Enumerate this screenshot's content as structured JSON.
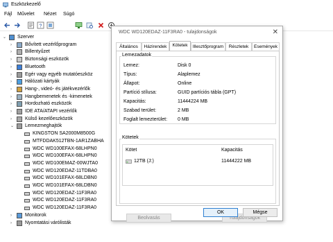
{
  "app": {
    "title": "Eszközkezelő",
    "menu": [
      "Fájl",
      "Művelet",
      "Nézet",
      "Súgó"
    ]
  },
  "toolbar": {
    "icons": [
      "back-arrow-icon",
      "forward-arrow-icon",
      "properties-icon",
      "help-icon",
      "update-driver-icon",
      "monitor-icon",
      "disable-device-icon",
      "uninstall-x-icon",
      "scan-hardware-icon"
    ]
  },
  "tree": {
    "root": "Szerver",
    "categories": [
      "Bővített vezérlőprogram",
      "Billentyűzet",
      "Biztonsági eszközök",
      "Bluetooth",
      "Egér vagy egyéb mutatóeszköz",
      "Hálózati kártyák",
      "Hang-, videó- és játékvezérlők",
      "Hangbemenetek és -kimenetek",
      "Hordozható eszközök",
      "IDE ATA/ATAPI vezérlők",
      "Külső kezelőeszközök",
      "Lemezmeghajtók"
    ],
    "disks": [
      "KINGSTON SA2000M8500G",
      "MTFDDAK512TBN-1AR1ZABHA",
      "WDC WD100EFAX-68LHPN0",
      "WDC WD100EFAX-68LHPN0",
      "WDC WD100EMAZ-00WJTA0",
      "WDC WD120EDAZ-11TDBA0",
      "WDC WD101EFAX-68LDBN0",
      "WDC WD101EFAX-68LDBN0",
      "WDC WD120EDAZ-11F3RA0",
      "WDC WD120EDAZ-11F3RA0",
      "WDC WD120EDAZ-11F3RA0"
    ],
    "after": [
      "Monitorok",
      "Nyomtatási várólisták"
    ]
  },
  "dialog": {
    "title": "WDC WD120EDAZ-11F3RA0 - tulajdonságok",
    "close": "✕",
    "tabs": [
      "Általános",
      "Házirendek",
      "Kötetek",
      "Illesztőprogram",
      "Részletek",
      "Események"
    ],
    "active_tab": "Kötetek",
    "disk_group": {
      "title": "Lemezadatok",
      "rows": [
        {
          "label": "Lemez:",
          "value": "Disk 0"
        },
        {
          "label": "Típus:",
          "value": "Alaplemez"
        },
        {
          "label": "Állapot:",
          "value": "Online"
        },
        {
          "label": "Partíció stílusa:",
          "value": "GUID partíciós tábla (GPT)"
        },
        {
          "label": "Kapacitás:",
          "value": "11444224 MB"
        },
        {
          "label": "Szabad terület:",
          "value": "2 MB"
        },
        {
          "label": "Foglalt lemezterület:",
          "value": "0 MB"
        }
      ]
    },
    "volumes_group": {
      "title": "Kötetek",
      "col_volume": "Kötet",
      "col_capacity": "Kapacitás",
      "volume_name": "12TB (J:)",
      "volume_capacity": "11444222 MB"
    },
    "buttons": {
      "populate": "Beolvasás",
      "properties": "Tulajdonságok",
      "ok": "OK",
      "cancel": "Mégse"
    }
  }
}
